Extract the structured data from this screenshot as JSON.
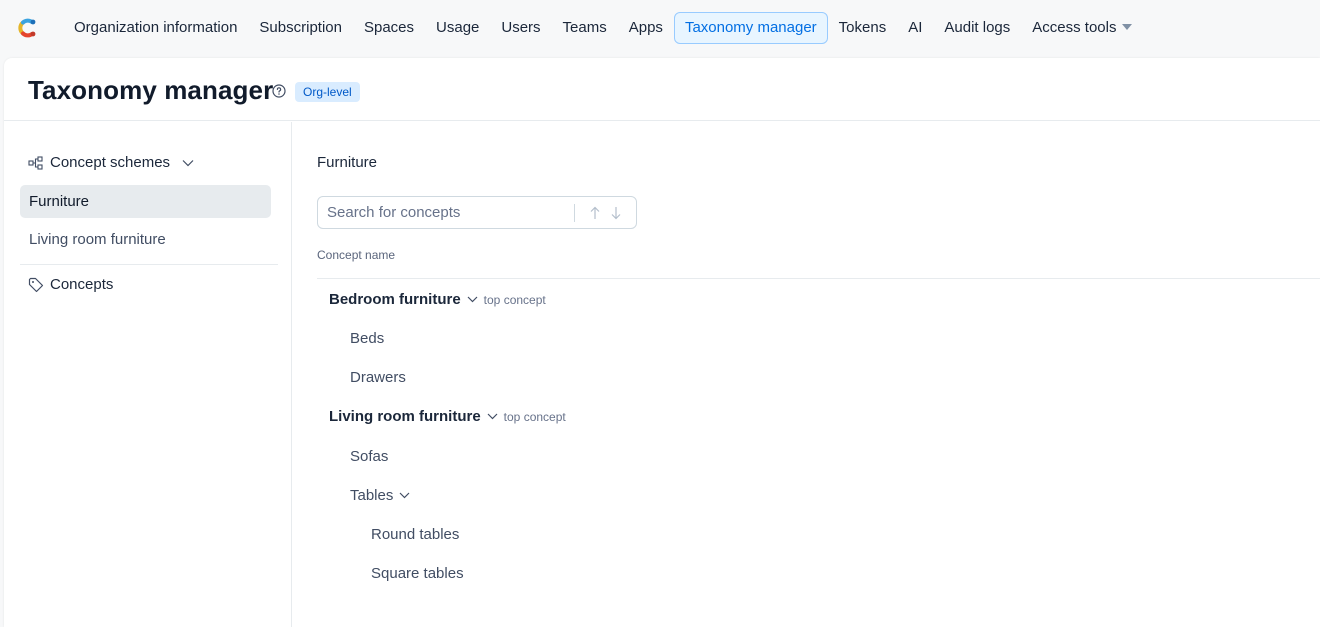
{
  "nav": {
    "items": [
      {
        "label": "Organization information",
        "name": "nav-organization-information"
      },
      {
        "label": "Subscription",
        "name": "nav-subscription"
      },
      {
        "label": "Spaces",
        "name": "nav-spaces"
      },
      {
        "label": "Usage",
        "name": "nav-usage"
      },
      {
        "label": "Users",
        "name": "nav-users"
      },
      {
        "label": "Teams",
        "name": "nav-teams"
      },
      {
        "label": "Apps",
        "name": "nav-apps"
      },
      {
        "label": "Taxonomy manager",
        "name": "nav-taxonomy-manager",
        "active": true
      },
      {
        "label": "Tokens",
        "name": "nav-tokens"
      },
      {
        "label": "AI",
        "name": "nav-ai"
      },
      {
        "label": "Audit logs",
        "name": "nav-audit-logs"
      },
      {
        "label": "Access tools",
        "name": "nav-access-tools",
        "dropdown": true
      }
    ],
    "logo_icon": "contentful-logo-icon"
  },
  "header": {
    "title": "Taxonomy manager",
    "help_icon": "question-circle-icon",
    "badge": "Org-level"
  },
  "sidebar": {
    "concept_schemes_label": "Concept schemes",
    "schemes": [
      {
        "label": "Furniture",
        "selected": true
      },
      {
        "label": "Living room furniture",
        "selected": false
      }
    ],
    "concepts_label": "Concepts"
  },
  "content": {
    "title": "Furniture",
    "search": {
      "placeholder": "Search for concepts",
      "value": ""
    },
    "column_header": "Concept name",
    "tree": [
      {
        "label": "Bedroom furniture",
        "level": 0,
        "expandable": true,
        "tag": "top concept"
      },
      {
        "label": "Beds",
        "level": 1
      },
      {
        "label": "Drawers",
        "level": 1
      },
      {
        "label": "Living room furniture",
        "level": 0,
        "expandable": true,
        "tag": "top concept"
      },
      {
        "label": "Sofas",
        "level": 1
      },
      {
        "label": "Tables",
        "level": 1,
        "expandable": true
      },
      {
        "label": "Round tables",
        "level": 2
      },
      {
        "label": "Square tables",
        "level": 2
      }
    ]
  },
  "colors": {
    "accent": "#036fe3",
    "active_bg": "#e8f5ff",
    "badge_bg": "#d9ecff",
    "selected_bg": "#e7ebee"
  }
}
